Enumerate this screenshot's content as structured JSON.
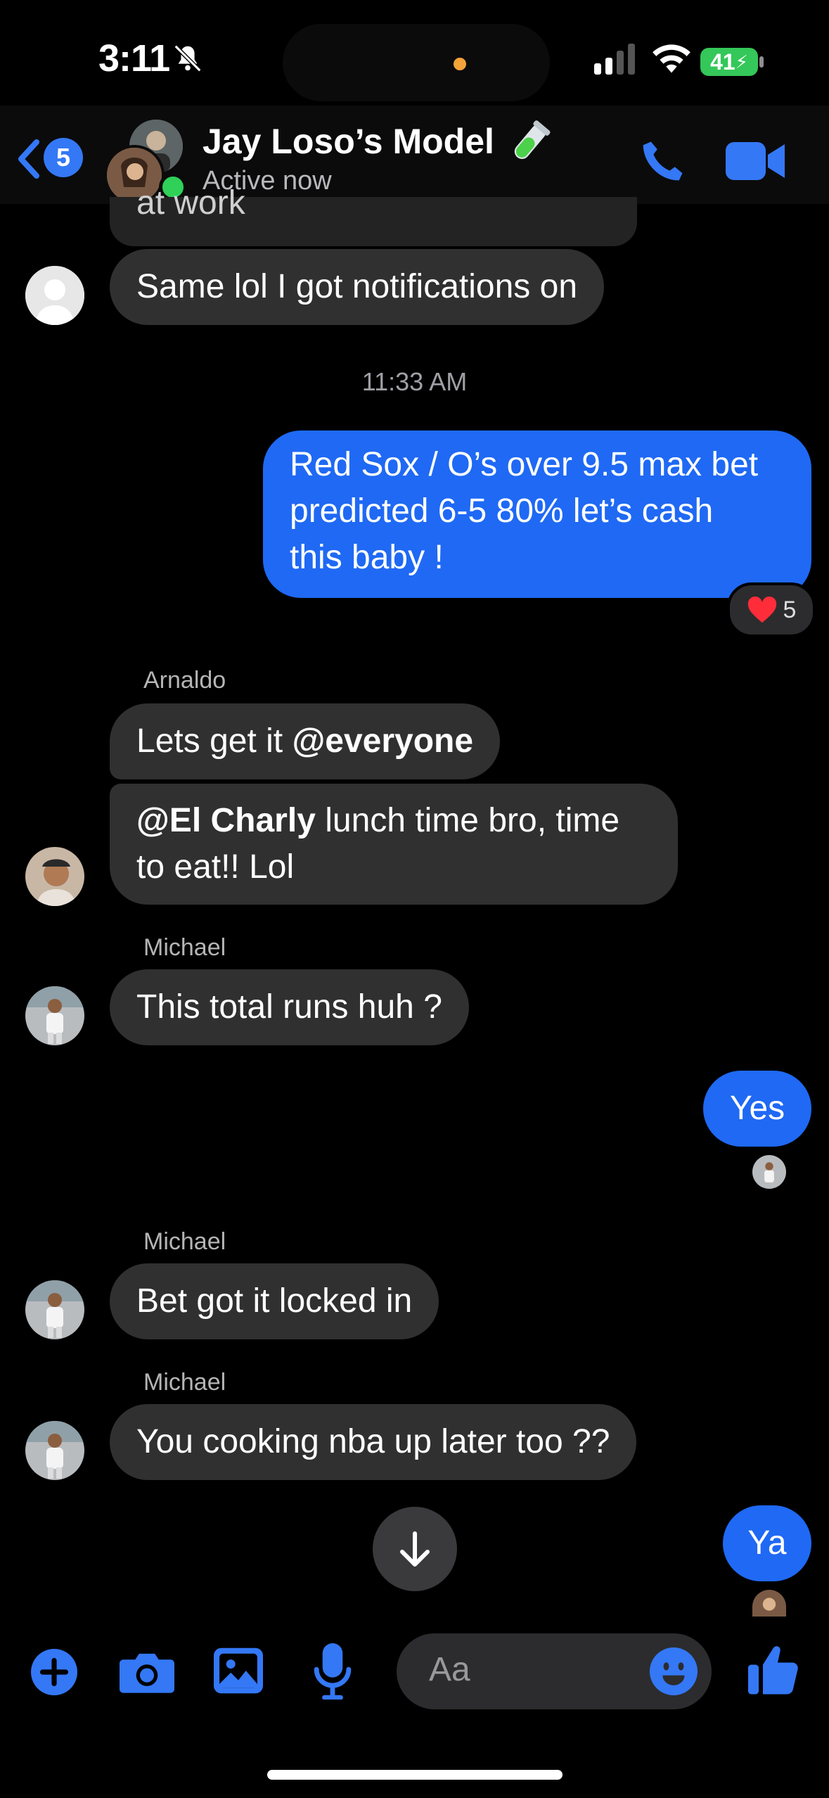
{
  "status_bar": {
    "time": "3:11",
    "battery": "41"
  },
  "header": {
    "back_badge": "5",
    "title": "Jay Loso’s Model",
    "status": "Active now"
  },
  "messages": {
    "partial_prev": "at work",
    "m1": "Same lol I got notifications on",
    "timestamp": "11:33 AM",
    "mine1_line1": "Red Sox / O’s over 9.5 max bet",
    "mine1_line2": "predicted 6-5 80% let’s cash",
    "mine1_line3": "this baby !",
    "reaction_count": "5",
    "sender_arnaldo": "Arnaldo",
    "a1_text": "Lets get it ",
    "a1_mention": "@everyone",
    "a2_mention": "@El Charly",
    "a2_text_line1": " lunch time bro, time",
    "a2_text_line2": "to eat!! Lol",
    "sender_michael_1": "Michael",
    "mi1": "This total runs huh ?",
    "mine2": "Yes",
    "sender_michael_2": "Michael",
    "mi2": "Bet got it locked in",
    "sender_michael_3": "Michael",
    "mi3": "You cooking nba up later too ??",
    "mine3": "Ya"
  },
  "composer": {
    "placeholder": "Aa"
  },
  "colors": {
    "accent": "#3478f6",
    "my_bubble": "#1f69f4",
    "their_bubble": "#303030",
    "online": "#2fd158"
  }
}
